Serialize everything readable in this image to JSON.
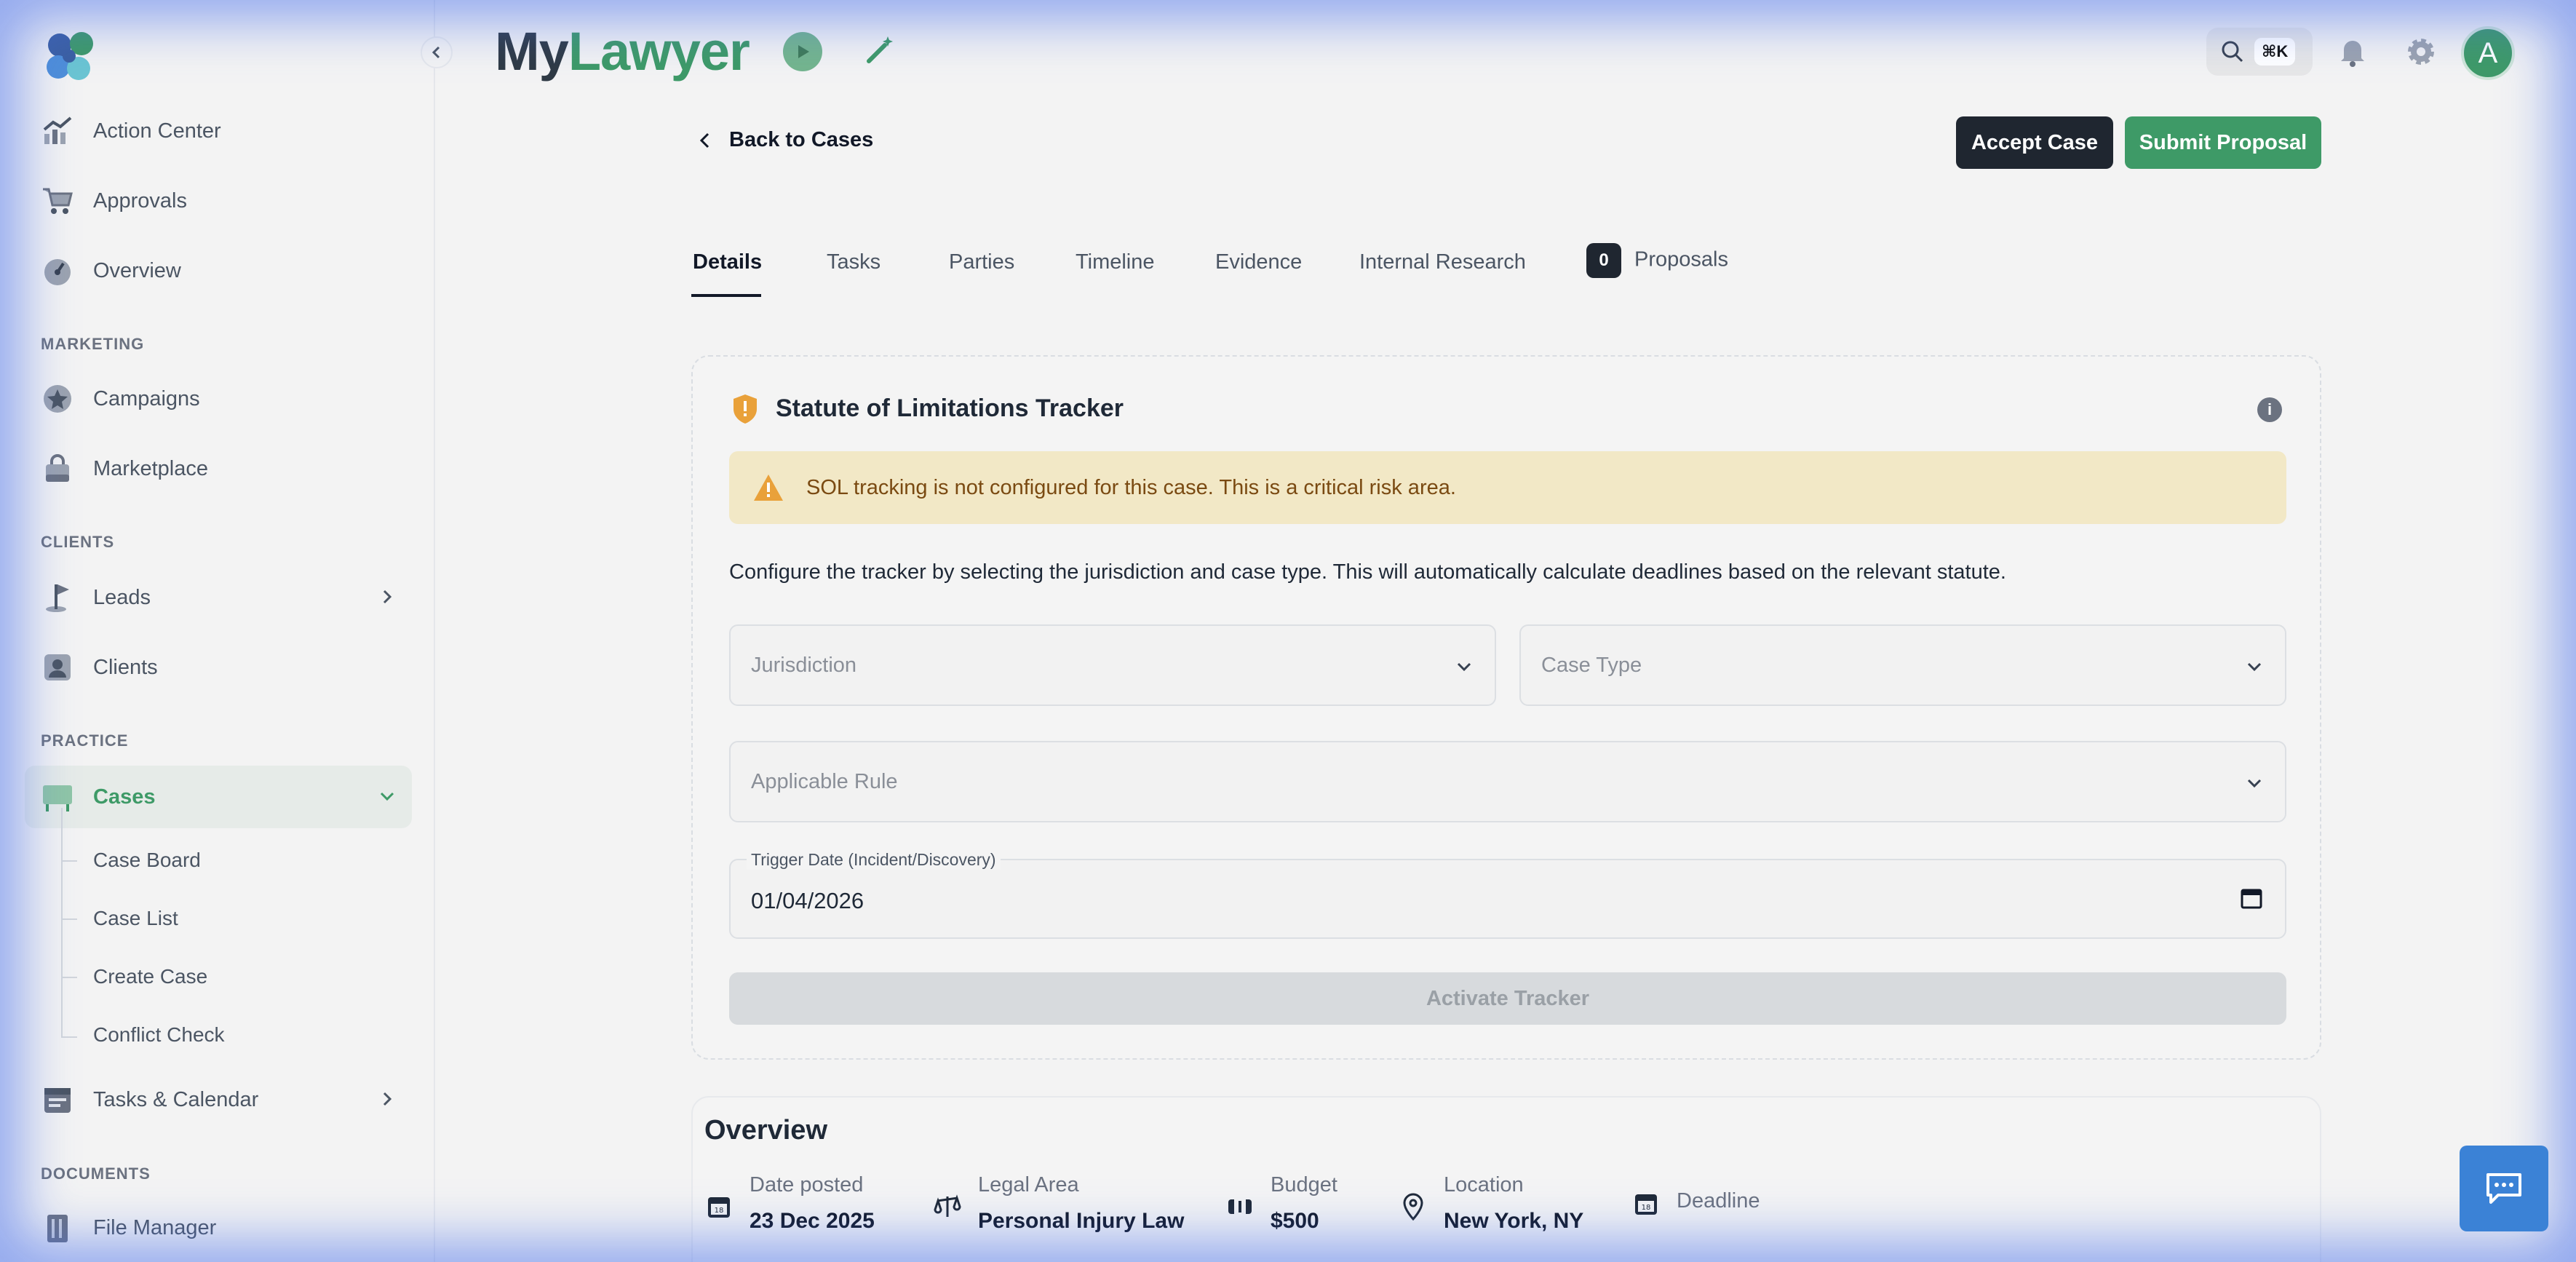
{
  "brand": {
    "part1": "My",
    "part2": "Lawyer"
  },
  "sidebar": {
    "items": [
      {
        "label": "Action Center"
      },
      {
        "label": "Approvals"
      },
      {
        "label": "Overview"
      }
    ],
    "sections": {
      "marketing": "MARKETING",
      "clients": "CLIENTS",
      "practice": "PRACTICE",
      "documents": "DOCUMENTS"
    },
    "marketing_items": [
      {
        "label": "Campaigns"
      },
      {
        "label": "Marketplace"
      }
    ],
    "client_items": [
      {
        "label": "Leads"
      },
      {
        "label": "Clients"
      }
    ],
    "practice_items": [
      {
        "label": "Cases"
      }
    ],
    "cases_sub": [
      "Case Board",
      "Case List",
      "Create Case",
      "Conflict Check"
    ],
    "tasks_label": "Tasks & Calendar",
    "file_manager": "File Manager"
  },
  "header": {
    "search_shortcut": "⌘K",
    "avatar_initial": "A"
  },
  "main": {
    "back_label": "Back to Cases",
    "accept_label": "Accept Case",
    "submit_label": "Submit Proposal",
    "tabs": [
      "Details",
      "Tasks",
      "Parties",
      "Timeline",
      "Evidence",
      "Internal Research",
      "Proposals"
    ],
    "proposals_count": "0"
  },
  "sol": {
    "title": "Statute of Limitations Tracker",
    "warning": "SOL tracking is not configured for this case. This is a critical risk area.",
    "description": "Configure the tracker by selecting the jurisdiction and case type. This will automatically calculate deadlines based on the relevant statute.",
    "jurisdiction_placeholder": "Jurisdiction",
    "case_type_placeholder": "Case Type",
    "rule_placeholder": "Applicable Rule",
    "trigger_label": "Trigger Date (Incident/Discovery)",
    "trigger_value": "01/04/2026",
    "activate_label": "Activate Tracker"
  },
  "overview": {
    "title": "Overview",
    "items": [
      {
        "label": "Date posted",
        "value": "23 Dec 2025"
      },
      {
        "label": "Legal Area",
        "value": "Personal Injury Law"
      },
      {
        "label": "Budget",
        "value": "$500"
      },
      {
        "label": "Location",
        "value": "New York, NY"
      },
      {
        "label": "Deadline",
        "value": ""
      }
    ]
  },
  "colors": {
    "accent": "#3e9a67",
    "dark": "#1f2630",
    "warning_bg": "#f2e8c6",
    "chat": "#3b82d6"
  }
}
